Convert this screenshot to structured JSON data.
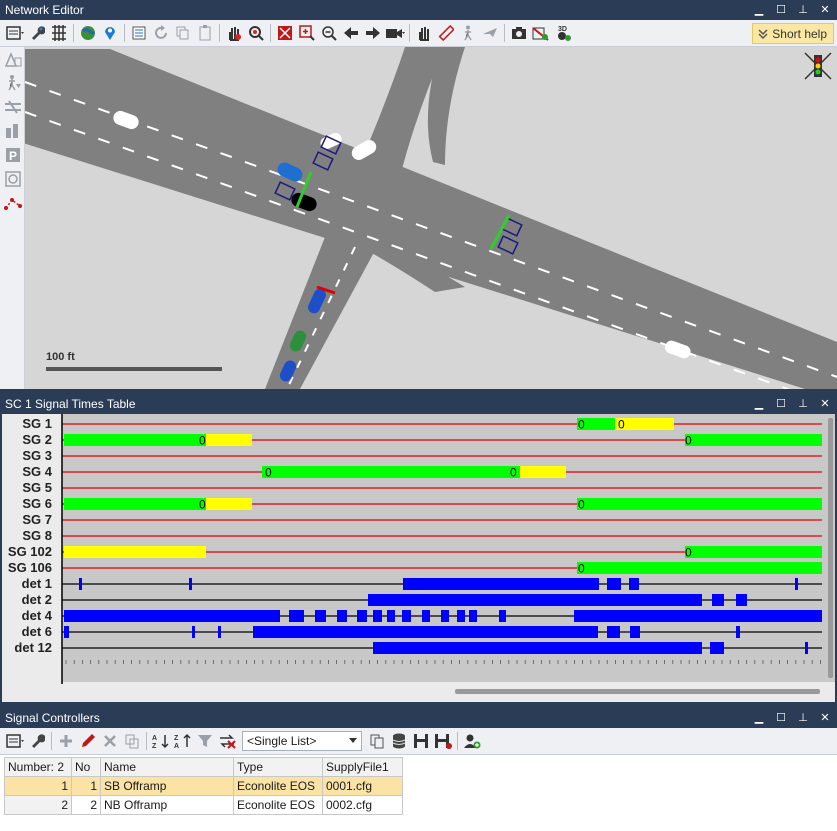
{
  "network_editor": {
    "title": "Network Editor",
    "short_help": "Short help",
    "scale_label": "100 ft",
    "toolbar_icons": [
      "layout-menu-icon",
      "wrench-icon",
      "network-grid-icon",
      "globe-icon",
      "map-pin-icon",
      "list-icon",
      "redo-icon",
      "copy-icon",
      "paste-icon",
      "hand-select-icon",
      "zoom-hand-icon",
      "zoom-fit-icon",
      "zoom-in-icon",
      "zoom-out-icon",
      "back-arrow-icon",
      "forward-arrow-icon",
      "camera-icon",
      "pan-hand-icon",
      "measure-icon",
      "pedestrian-icon",
      "plane-icon",
      "screenshot-icon",
      "no-3d-icon",
      "3d-icon"
    ],
    "left_icons": [
      "warning-signs-icon",
      "pedestrian-icon",
      "road-icon",
      "parking-icon",
      "transit-icon",
      "detector-icon",
      "signal-link-icon"
    ]
  },
  "signal_times": {
    "title": "SC 1 Signal Times Table",
    "rows": [
      {
        "label": "SG 1",
        "type": "sg"
      },
      {
        "label": "SG 2",
        "type": "sg"
      },
      {
        "label": "SG 3",
        "type": "sg"
      },
      {
        "label": "SG 4",
        "type": "sg"
      },
      {
        "label": "SG 5",
        "type": "sg"
      },
      {
        "label": "SG 6",
        "type": "sg"
      },
      {
        "label": "SG 7",
        "type": "sg"
      },
      {
        "label": "SG 8",
        "type": "sg"
      },
      {
        "label": "SG 102",
        "type": "sg"
      },
      {
        "label": "SG 106",
        "type": "sg"
      },
      {
        "label": "det  1",
        "type": "det"
      },
      {
        "label": "det  2",
        "type": "det"
      },
      {
        "label": "det  4",
        "type": "det"
      },
      {
        "label": "det  6",
        "type": "det"
      },
      {
        "label": "det 12",
        "type": "det"
      }
    ],
    "zero_marker": "0"
  },
  "signal_controllers": {
    "title": "Signal Controllers",
    "list_mode": "<Single List>",
    "columns": [
      "Number: 2",
      "No",
      "Name",
      "Type",
      "SupplyFile1"
    ],
    "rows": [
      {
        "index": "1",
        "no": "1",
        "name": "SB Offramp",
        "type": "Econolite EOS",
        "file": "0001.cfg"
      },
      {
        "index": "2",
        "no": "2",
        "name": "NB Offramp",
        "type": "Econolite EOS",
        "file": "0002.cfg"
      }
    ]
  },
  "colors": {
    "green": "#00ff00",
    "yellow": "#ffff00",
    "red": "#e00000",
    "blue": "#0000ff",
    "title_bar": "#2b3d56"
  }
}
